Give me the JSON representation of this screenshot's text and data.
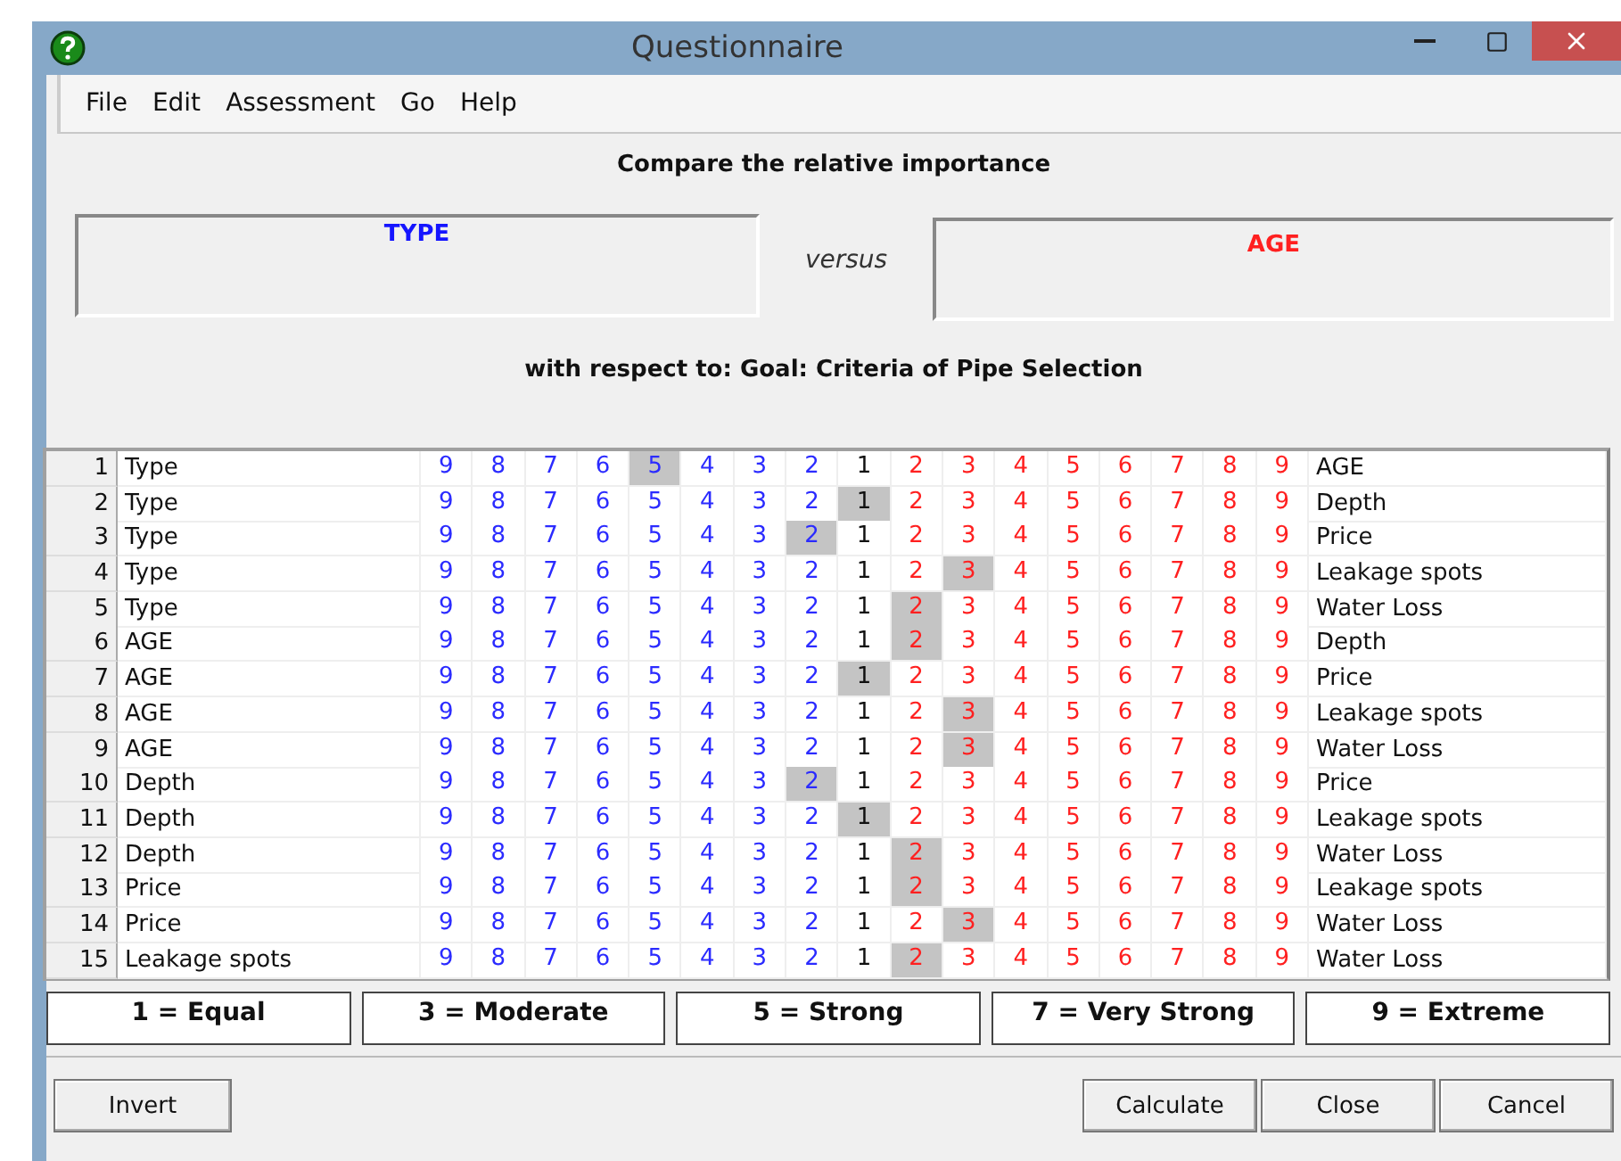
{
  "window": {
    "title": "Questionnaire"
  },
  "menu": [
    "File",
    "Edit",
    "Assessment",
    "Go",
    "Help"
  ],
  "heading": "Compare the relative importance",
  "left_item": "TYPE",
  "versus": "versus",
  "right_item": "AGE",
  "context": "with respect to: Goal: Criteria of Pipe Selection",
  "comparisons": [
    {
      "number": "1",
      "left": "Type",
      "right": "AGE",
      "cells": [
        {
          "label": "9",
          "kind": "left",
          "selected": false
        },
        {
          "label": "8",
          "kind": "left",
          "selected": false
        },
        {
          "label": "7",
          "kind": "left",
          "selected": false
        },
        {
          "label": "6",
          "kind": "left",
          "selected": false
        },
        {
          "label": "5",
          "kind": "left",
          "selected": true
        },
        {
          "label": "4",
          "kind": "left",
          "selected": false
        },
        {
          "label": "3",
          "kind": "left",
          "selected": false
        },
        {
          "label": "2",
          "kind": "left",
          "selected": false
        },
        {
          "label": "1",
          "kind": "equal",
          "selected": false
        },
        {
          "label": "2",
          "kind": "right",
          "selected": false
        },
        {
          "label": "3",
          "kind": "right",
          "selected": false
        },
        {
          "label": "4",
          "kind": "right",
          "selected": false
        },
        {
          "label": "5",
          "kind": "right",
          "selected": false
        },
        {
          "label": "6",
          "kind": "right",
          "selected": false
        },
        {
          "label": "7",
          "kind": "right",
          "selected": false
        },
        {
          "label": "8",
          "kind": "right",
          "selected": false
        },
        {
          "label": "9",
          "kind": "right",
          "selected": false
        }
      ]
    },
    {
      "number": "2",
      "left": "Type",
      "right": "Depth",
      "cells": [
        {
          "label": "9",
          "kind": "left",
          "selected": false
        },
        {
          "label": "8",
          "kind": "left",
          "selected": false
        },
        {
          "label": "7",
          "kind": "left",
          "selected": false
        },
        {
          "label": "6",
          "kind": "left",
          "selected": false
        },
        {
          "label": "5",
          "kind": "left",
          "selected": false
        },
        {
          "label": "4",
          "kind": "left",
          "selected": false
        },
        {
          "label": "3",
          "kind": "left",
          "selected": false
        },
        {
          "label": "2",
          "kind": "left",
          "selected": false
        },
        {
          "label": "1",
          "kind": "equal",
          "selected": true
        },
        {
          "label": "2",
          "kind": "right",
          "selected": false
        },
        {
          "label": "3",
          "kind": "right",
          "selected": false
        },
        {
          "label": "4",
          "kind": "right",
          "selected": false
        },
        {
          "label": "5",
          "kind": "right",
          "selected": false
        },
        {
          "label": "6",
          "kind": "right",
          "selected": false
        },
        {
          "label": "7",
          "kind": "right",
          "selected": false
        },
        {
          "label": "8",
          "kind": "right",
          "selected": false
        },
        {
          "label": "9",
          "kind": "right",
          "selected": false
        }
      ]
    },
    {
      "number": "3",
      "left": "Type",
      "right": "Price",
      "cells": [
        {
          "label": "9",
          "kind": "left",
          "selected": false
        },
        {
          "label": "8",
          "kind": "left",
          "selected": false
        },
        {
          "label": "7",
          "kind": "left",
          "selected": false
        },
        {
          "label": "6",
          "kind": "left",
          "selected": false
        },
        {
          "label": "5",
          "kind": "left",
          "selected": false
        },
        {
          "label": "4",
          "kind": "left",
          "selected": false
        },
        {
          "label": "3",
          "kind": "left",
          "selected": false
        },
        {
          "label": "2",
          "kind": "left",
          "selected": true
        },
        {
          "label": "1",
          "kind": "equal",
          "selected": false
        },
        {
          "label": "2",
          "kind": "right",
          "selected": false
        },
        {
          "label": "3",
          "kind": "right",
          "selected": false
        },
        {
          "label": "4",
          "kind": "right",
          "selected": false
        },
        {
          "label": "5",
          "kind": "right",
          "selected": false
        },
        {
          "label": "6",
          "kind": "right",
          "selected": false
        },
        {
          "label": "7",
          "kind": "right",
          "selected": false
        },
        {
          "label": "8",
          "kind": "right",
          "selected": false
        },
        {
          "label": "9",
          "kind": "right",
          "selected": false
        }
      ]
    },
    {
      "number": "4",
      "left": "Type",
      "right": "Leakage spots",
      "cells": [
        {
          "label": "9",
          "kind": "left",
          "selected": false
        },
        {
          "label": "8",
          "kind": "left",
          "selected": false
        },
        {
          "label": "7",
          "kind": "left",
          "selected": false
        },
        {
          "label": "6",
          "kind": "left",
          "selected": false
        },
        {
          "label": "5",
          "kind": "left",
          "selected": false
        },
        {
          "label": "4",
          "kind": "left",
          "selected": false
        },
        {
          "label": "3",
          "kind": "left",
          "selected": false
        },
        {
          "label": "2",
          "kind": "left",
          "selected": false
        },
        {
          "label": "1",
          "kind": "equal",
          "selected": false
        },
        {
          "label": "2",
          "kind": "right",
          "selected": false
        },
        {
          "label": "3",
          "kind": "right",
          "selected": true
        },
        {
          "label": "4",
          "kind": "right",
          "selected": false
        },
        {
          "label": "5",
          "kind": "right",
          "selected": false
        },
        {
          "label": "6",
          "kind": "right",
          "selected": false
        },
        {
          "label": "7",
          "kind": "right",
          "selected": false
        },
        {
          "label": "8",
          "kind": "right",
          "selected": false
        },
        {
          "label": "9",
          "kind": "right",
          "selected": false
        }
      ]
    },
    {
      "number": "5",
      "left": "Type",
      "right": "Water Loss",
      "cells": [
        {
          "label": "9",
          "kind": "left",
          "selected": false
        },
        {
          "label": "8",
          "kind": "left",
          "selected": false
        },
        {
          "label": "7",
          "kind": "left",
          "selected": false
        },
        {
          "label": "6",
          "kind": "left",
          "selected": false
        },
        {
          "label": "5",
          "kind": "left",
          "selected": false
        },
        {
          "label": "4",
          "kind": "left",
          "selected": false
        },
        {
          "label": "3",
          "kind": "left",
          "selected": false
        },
        {
          "label": "2",
          "kind": "left",
          "selected": false
        },
        {
          "label": "1",
          "kind": "equal",
          "selected": false
        },
        {
          "label": "2",
          "kind": "right",
          "selected": true
        },
        {
          "label": "3",
          "kind": "right",
          "selected": false
        },
        {
          "label": "4",
          "kind": "right",
          "selected": false
        },
        {
          "label": "5",
          "kind": "right",
          "selected": false
        },
        {
          "label": "6",
          "kind": "right",
          "selected": false
        },
        {
          "label": "7",
          "kind": "right",
          "selected": false
        },
        {
          "label": "8",
          "kind": "right",
          "selected": false
        },
        {
          "label": "9",
          "kind": "right",
          "selected": false
        }
      ]
    },
    {
      "number": "6",
      "left": "AGE",
      "right": "Depth",
      "cells": [
        {
          "label": "9",
          "kind": "left",
          "selected": false
        },
        {
          "label": "8",
          "kind": "left",
          "selected": false
        },
        {
          "label": "7",
          "kind": "left",
          "selected": false
        },
        {
          "label": "6",
          "kind": "left",
          "selected": false
        },
        {
          "label": "5",
          "kind": "left",
          "selected": false
        },
        {
          "label": "4",
          "kind": "left",
          "selected": false
        },
        {
          "label": "3",
          "kind": "left",
          "selected": false
        },
        {
          "label": "2",
          "kind": "left",
          "selected": false
        },
        {
          "label": "1",
          "kind": "equal",
          "selected": false
        },
        {
          "label": "2",
          "kind": "right",
          "selected": true
        },
        {
          "label": "3",
          "kind": "right",
          "selected": false
        },
        {
          "label": "4",
          "kind": "right",
          "selected": false
        },
        {
          "label": "5",
          "kind": "right",
          "selected": false
        },
        {
          "label": "6",
          "kind": "right",
          "selected": false
        },
        {
          "label": "7",
          "kind": "right",
          "selected": false
        },
        {
          "label": "8",
          "kind": "right",
          "selected": false
        },
        {
          "label": "9",
          "kind": "right",
          "selected": false
        }
      ]
    },
    {
      "number": "7",
      "left": "AGE",
      "right": "Price",
      "cells": [
        {
          "label": "9",
          "kind": "left",
          "selected": false
        },
        {
          "label": "8",
          "kind": "left",
          "selected": false
        },
        {
          "label": "7",
          "kind": "left",
          "selected": false
        },
        {
          "label": "6",
          "kind": "left",
          "selected": false
        },
        {
          "label": "5",
          "kind": "left",
          "selected": false
        },
        {
          "label": "4",
          "kind": "left",
          "selected": false
        },
        {
          "label": "3",
          "kind": "left",
          "selected": false
        },
        {
          "label": "2",
          "kind": "left",
          "selected": false
        },
        {
          "label": "1",
          "kind": "equal",
          "selected": true
        },
        {
          "label": "2",
          "kind": "right",
          "selected": false
        },
        {
          "label": "3",
          "kind": "right",
          "selected": false
        },
        {
          "label": "4",
          "kind": "right",
          "selected": false
        },
        {
          "label": "5",
          "kind": "right",
          "selected": false
        },
        {
          "label": "6",
          "kind": "right",
          "selected": false
        },
        {
          "label": "7",
          "kind": "right",
          "selected": false
        },
        {
          "label": "8",
          "kind": "right",
          "selected": false
        },
        {
          "label": "9",
          "kind": "right",
          "selected": false
        }
      ]
    },
    {
      "number": "8",
      "left": "AGE",
      "right": "Leakage spots",
      "cells": [
        {
          "label": "9",
          "kind": "left",
          "selected": false
        },
        {
          "label": "8",
          "kind": "left",
          "selected": false
        },
        {
          "label": "7",
          "kind": "left",
          "selected": false
        },
        {
          "label": "6",
          "kind": "left",
          "selected": false
        },
        {
          "label": "5",
          "kind": "left",
          "selected": false
        },
        {
          "label": "4",
          "kind": "left",
          "selected": false
        },
        {
          "label": "3",
          "kind": "left",
          "selected": false
        },
        {
          "label": "2",
          "kind": "left",
          "selected": false
        },
        {
          "label": "1",
          "kind": "equal",
          "selected": false
        },
        {
          "label": "2",
          "kind": "right",
          "selected": false
        },
        {
          "label": "3",
          "kind": "right",
          "selected": true
        },
        {
          "label": "4",
          "kind": "right",
          "selected": false
        },
        {
          "label": "5",
          "kind": "right",
          "selected": false
        },
        {
          "label": "6",
          "kind": "right",
          "selected": false
        },
        {
          "label": "7",
          "kind": "right",
          "selected": false
        },
        {
          "label": "8",
          "kind": "right",
          "selected": false
        },
        {
          "label": "9",
          "kind": "right",
          "selected": false
        }
      ]
    },
    {
      "number": "9",
      "left": "AGE",
      "right": "Water Loss",
      "cells": [
        {
          "label": "9",
          "kind": "left",
          "selected": false
        },
        {
          "label": "8",
          "kind": "left",
          "selected": false
        },
        {
          "label": "7",
          "kind": "left",
          "selected": false
        },
        {
          "label": "6",
          "kind": "left",
          "selected": false
        },
        {
          "label": "5",
          "kind": "left",
          "selected": false
        },
        {
          "label": "4",
          "kind": "left",
          "selected": false
        },
        {
          "label": "3",
          "kind": "left",
          "selected": false
        },
        {
          "label": "2",
          "kind": "left",
          "selected": false
        },
        {
          "label": "1",
          "kind": "equal",
          "selected": false
        },
        {
          "label": "2",
          "kind": "right",
          "selected": false
        },
        {
          "label": "3",
          "kind": "right",
          "selected": true
        },
        {
          "label": "4",
          "kind": "right",
          "selected": false
        },
        {
          "label": "5",
          "kind": "right",
          "selected": false
        },
        {
          "label": "6",
          "kind": "right",
          "selected": false
        },
        {
          "label": "7",
          "kind": "right",
          "selected": false
        },
        {
          "label": "8",
          "kind": "right",
          "selected": false
        },
        {
          "label": "9",
          "kind": "right",
          "selected": false
        }
      ]
    },
    {
      "number": "10",
      "left": "Depth",
      "right": "Price",
      "cells": [
        {
          "label": "9",
          "kind": "left",
          "selected": false
        },
        {
          "label": "8",
          "kind": "left",
          "selected": false
        },
        {
          "label": "7",
          "kind": "left",
          "selected": false
        },
        {
          "label": "6",
          "kind": "left",
          "selected": false
        },
        {
          "label": "5",
          "kind": "left",
          "selected": false
        },
        {
          "label": "4",
          "kind": "left",
          "selected": false
        },
        {
          "label": "3",
          "kind": "left",
          "selected": false
        },
        {
          "label": "2",
          "kind": "left",
          "selected": true
        },
        {
          "label": "1",
          "kind": "equal",
          "selected": false
        },
        {
          "label": "2",
          "kind": "right",
          "selected": false
        },
        {
          "label": "3",
          "kind": "right",
          "selected": false
        },
        {
          "label": "4",
          "kind": "right",
          "selected": false
        },
        {
          "label": "5",
          "kind": "right",
          "selected": false
        },
        {
          "label": "6",
          "kind": "right",
          "selected": false
        },
        {
          "label": "7",
          "kind": "right",
          "selected": false
        },
        {
          "label": "8",
          "kind": "right",
          "selected": false
        },
        {
          "label": "9",
          "kind": "right",
          "selected": false
        }
      ]
    },
    {
      "number": "11",
      "left": "Depth",
      "right": "Leakage spots",
      "cells": [
        {
          "label": "9",
          "kind": "left",
          "selected": false
        },
        {
          "label": "8",
          "kind": "left",
          "selected": false
        },
        {
          "label": "7",
          "kind": "left",
          "selected": false
        },
        {
          "label": "6",
          "kind": "left",
          "selected": false
        },
        {
          "label": "5",
          "kind": "left",
          "selected": false
        },
        {
          "label": "4",
          "kind": "left",
          "selected": false
        },
        {
          "label": "3",
          "kind": "left",
          "selected": false
        },
        {
          "label": "2",
          "kind": "left",
          "selected": false
        },
        {
          "label": "1",
          "kind": "equal",
          "selected": true
        },
        {
          "label": "2",
          "kind": "right",
          "selected": false
        },
        {
          "label": "3",
          "kind": "right",
          "selected": false
        },
        {
          "label": "4",
          "kind": "right",
          "selected": false
        },
        {
          "label": "5",
          "kind": "right",
          "selected": false
        },
        {
          "label": "6",
          "kind": "right",
          "selected": false
        },
        {
          "label": "7",
          "kind": "right",
          "selected": false
        },
        {
          "label": "8",
          "kind": "right",
          "selected": false
        },
        {
          "label": "9",
          "kind": "right",
          "selected": false
        }
      ]
    },
    {
      "number": "12",
      "left": "Depth",
      "right": "Water Loss",
      "cells": [
        {
          "label": "9",
          "kind": "left",
          "selected": false
        },
        {
          "label": "8",
          "kind": "left",
          "selected": false
        },
        {
          "label": "7",
          "kind": "left",
          "selected": false
        },
        {
          "label": "6",
          "kind": "left",
          "selected": false
        },
        {
          "label": "5",
          "kind": "left",
          "selected": false
        },
        {
          "label": "4",
          "kind": "left",
          "selected": false
        },
        {
          "label": "3",
          "kind": "left",
          "selected": false
        },
        {
          "label": "2",
          "kind": "left",
          "selected": false
        },
        {
          "label": "1",
          "kind": "equal",
          "selected": false
        },
        {
          "label": "2",
          "kind": "right",
          "selected": true
        },
        {
          "label": "3",
          "kind": "right",
          "selected": false
        },
        {
          "label": "4",
          "kind": "right",
          "selected": false
        },
        {
          "label": "5",
          "kind": "right",
          "selected": false
        },
        {
          "label": "6",
          "kind": "right",
          "selected": false
        },
        {
          "label": "7",
          "kind": "right",
          "selected": false
        },
        {
          "label": "8",
          "kind": "right",
          "selected": false
        },
        {
          "label": "9",
          "kind": "right",
          "selected": false
        }
      ]
    },
    {
      "number": "13",
      "left": "Price",
      "right": "Leakage spots",
      "cells": [
        {
          "label": "9",
          "kind": "left",
          "selected": false
        },
        {
          "label": "8",
          "kind": "left",
          "selected": false
        },
        {
          "label": "7",
          "kind": "left",
          "selected": false
        },
        {
          "label": "6",
          "kind": "left",
          "selected": false
        },
        {
          "label": "5",
          "kind": "left",
          "selected": false
        },
        {
          "label": "4",
          "kind": "left",
          "selected": false
        },
        {
          "label": "3",
          "kind": "left",
          "selected": false
        },
        {
          "label": "2",
          "kind": "left",
          "selected": false
        },
        {
          "label": "1",
          "kind": "equal",
          "selected": false
        },
        {
          "label": "2",
          "kind": "right",
          "selected": true
        },
        {
          "label": "3",
          "kind": "right",
          "selected": false
        },
        {
          "label": "4",
          "kind": "right",
          "selected": false
        },
        {
          "label": "5",
          "kind": "right",
          "selected": false
        },
        {
          "label": "6",
          "kind": "right",
          "selected": false
        },
        {
          "label": "7",
          "kind": "right",
          "selected": false
        },
        {
          "label": "8",
          "kind": "right",
          "selected": false
        },
        {
          "label": "9",
          "kind": "right",
          "selected": false
        }
      ]
    },
    {
      "number": "14",
      "left": "Price",
      "right": "Water Loss",
      "cells": [
        {
          "label": "9",
          "kind": "left",
          "selected": false
        },
        {
          "label": "8",
          "kind": "left",
          "selected": false
        },
        {
          "label": "7",
          "kind": "left",
          "selected": false
        },
        {
          "label": "6",
          "kind": "left",
          "selected": false
        },
        {
          "label": "5",
          "kind": "left",
          "selected": false
        },
        {
          "label": "4",
          "kind": "left",
          "selected": false
        },
        {
          "label": "3",
          "kind": "left",
          "selected": false
        },
        {
          "label": "2",
          "kind": "left",
          "selected": false
        },
        {
          "label": "1",
          "kind": "equal",
          "selected": false
        },
        {
          "label": "2",
          "kind": "right",
          "selected": false
        },
        {
          "label": "3",
          "kind": "right",
          "selected": true
        },
        {
          "label": "4",
          "kind": "right",
          "selected": false
        },
        {
          "label": "5",
          "kind": "right",
          "selected": false
        },
        {
          "label": "6",
          "kind": "right",
          "selected": false
        },
        {
          "label": "7",
          "kind": "right",
          "selected": false
        },
        {
          "label": "8",
          "kind": "right",
          "selected": false
        },
        {
          "label": "9",
          "kind": "right",
          "selected": false
        }
      ]
    },
    {
      "number": "15",
      "left": "Leakage spots",
      "right": "Water Loss",
      "cells": [
        {
          "label": "9",
          "kind": "left",
          "selected": false
        },
        {
          "label": "8",
          "kind": "left",
          "selected": false
        },
        {
          "label": "7",
          "kind": "left",
          "selected": false
        },
        {
          "label": "6",
          "kind": "left",
          "selected": false
        },
        {
          "label": "5",
          "kind": "left",
          "selected": false
        },
        {
          "label": "4",
          "kind": "left",
          "selected": false
        },
        {
          "label": "3",
          "kind": "left",
          "selected": false
        },
        {
          "label": "2",
          "kind": "left",
          "selected": false
        },
        {
          "label": "1",
          "kind": "equal",
          "selected": false
        },
        {
          "label": "2",
          "kind": "right",
          "selected": true
        },
        {
          "label": "3",
          "kind": "right",
          "selected": false
        },
        {
          "label": "4",
          "kind": "right",
          "selected": false
        },
        {
          "label": "5",
          "kind": "right",
          "selected": false
        },
        {
          "label": "6",
          "kind": "right",
          "selected": false
        },
        {
          "label": "7",
          "kind": "right",
          "selected": false
        },
        {
          "label": "8",
          "kind": "right",
          "selected": false
        },
        {
          "label": "9",
          "kind": "right",
          "selected": false
        }
      ]
    }
  ],
  "legend": [
    "1 = Equal",
    "3 = Moderate",
    "5 = Strong",
    "7 = Very Strong",
    "9 = Extreme"
  ],
  "left_buttons": [
    "Invert"
  ],
  "right_buttons": [
    "Calculate",
    "Close",
    "Cancel"
  ]
}
